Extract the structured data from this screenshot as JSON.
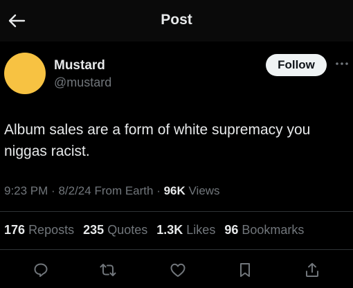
{
  "header": {
    "title": "Post"
  },
  "author": {
    "display_name": "Mustard",
    "handle": "@mustard",
    "avatar_color": "#f7c242",
    "follow_label": "Follow"
  },
  "tweet": {
    "text": "Album sales are a form of white supremacy you niggas racist.",
    "time": "9:23 PM",
    "date": "8/2/24",
    "source": "From Earth",
    "views_count": "96K",
    "views_label": "Views"
  },
  "stats": {
    "reposts_count": "176",
    "reposts_label": "Reposts",
    "quotes_count": "235",
    "quotes_label": "Quotes",
    "likes_count": "1.3K",
    "likes_label": "Likes",
    "bookmarks_count": "96",
    "bookmarks_label": "Bookmarks"
  },
  "actions": [
    "reply-icon",
    "repost-icon",
    "like-icon",
    "bookmark-icon",
    "share-icon"
  ],
  "colors": {
    "background": "#000000",
    "text": "#e7e9ea",
    "secondary": "#71767b",
    "divider": "#2f3336",
    "follow_bg": "#eff3f4"
  }
}
